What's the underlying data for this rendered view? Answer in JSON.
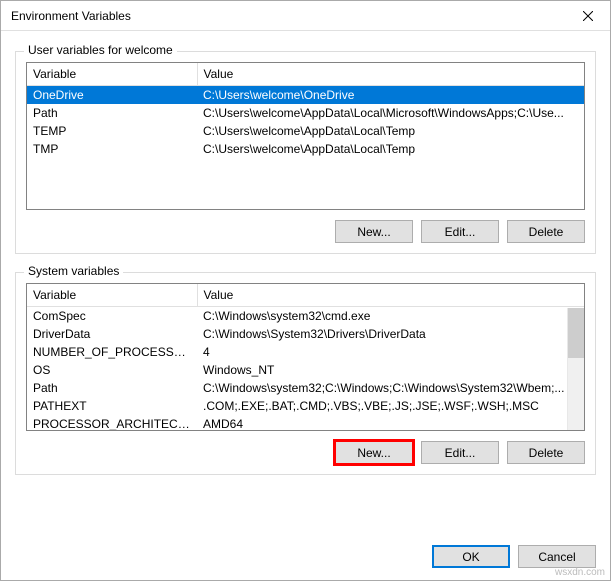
{
  "window": {
    "title": "Environment Variables"
  },
  "userSection": {
    "label": "User variables for welcome",
    "headers": {
      "var": "Variable",
      "val": "Value"
    },
    "rows": [
      {
        "var": "OneDrive",
        "val": "C:\\Users\\welcome\\OneDrive"
      },
      {
        "var": "Path",
        "val": "C:\\Users\\welcome\\AppData\\Local\\Microsoft\\WindowsApps;C:\\Use..."
      },
      {
        "var": "TEMP",
        "val": "C:\\Users\\welcome\\AppData\\Local\\Temp"
      },
      {
        "var": "TMP",
        "val": "C:\\Users\\welcome\\AppData\\Local\\Temp"
      }
    ],
    "buttons": {
      "new": "New...",
      "edit": "Edit...",
      "delete": "Delete"
    }
  },
  "systemSection": {
    "label": "System variables",
    "headers": {
      "var": "Variable",
      "val": "Value"
    },
    "rows": [
      {
        "var": "ComSpec",
        "val": "C:\\Windows\\system32\\cmd.exe"
      },
      {
        "var": "DriverData",
        "val": "C:\\Windows\\System32\\Drivers\\DriverData"
      },
      {
        "var": "NUMBER_OF_PROCESSORS",
        "val": "4"
      },
      {
        "var": "OS",
        "val": "Windows_NT"
      },
      {
        "var": "Path",
        "val": "C:\\Windows\\system32;C:\\Windows;C:\\Windows\\System32\\Wbem;..."
      },
      {
        "var": "PATHEXT",
        "val": ".COM;.EXE;.BAT;.CMD;.VBS;.VBE;.JS;.JSE;.WSF;.WSH;.MSC"
      },
      {
        "var": "PROCESSOR_ARCHITECTURE",
        "val": "AMD64"
      }
    ],
    "buttons": {
      "new": "New...",
      "edit": "Edit...",
      "delete": "Delete"
    }
  },
  "footer": {
    "ok": "OK",
    "cancel": "Cancel"
  },
  "watermark": "wsxdn.com"
}
